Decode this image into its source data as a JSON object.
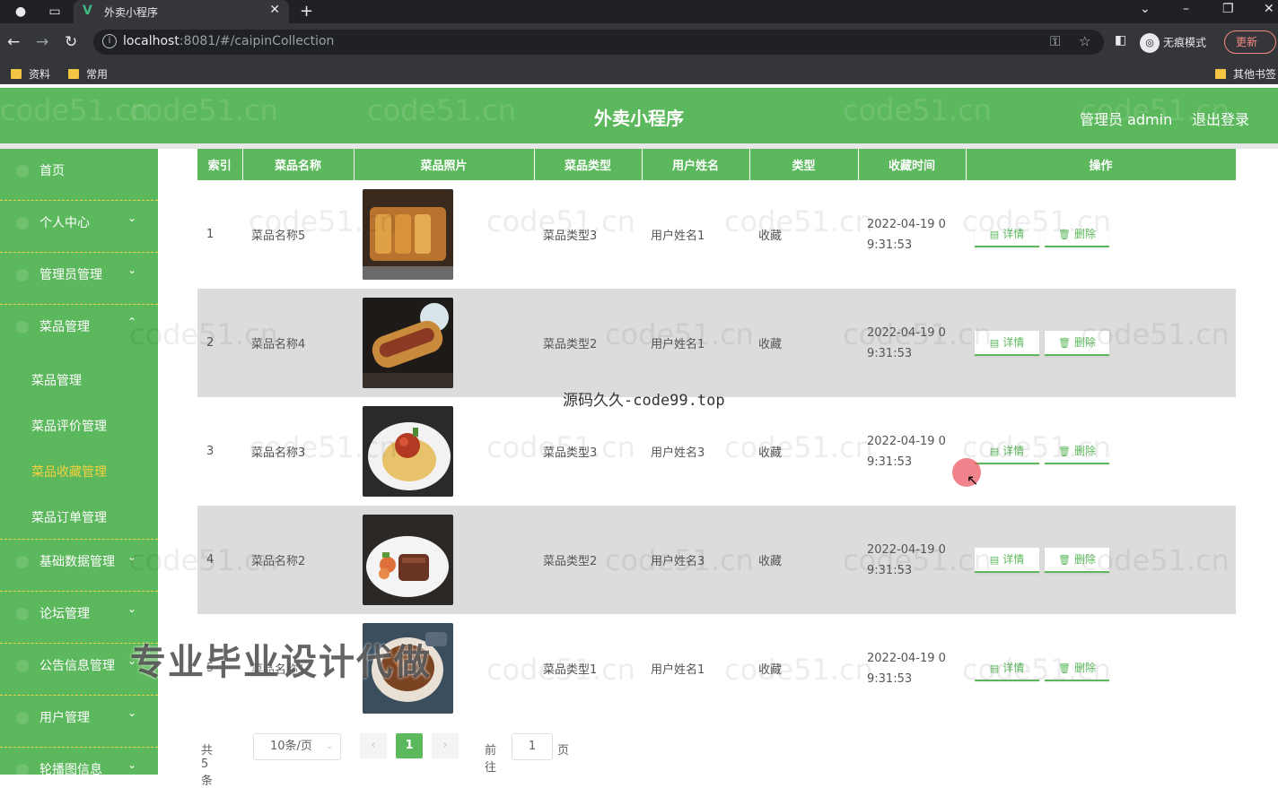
{
  "browser": {
    "tab_title": "外卖小程序",
    "tab_favicon": "V",
    "url_host": "localhost",
    "url_rest": ":8081/#/caipinCollection",
    "incognito_label": "无痕模式",
    "update_label": "更新",
    "bookmarks": [
      "资料",
      "常用"
    ],
    "other_bookmarks": "其他书签"
  },
  "header": {
    "title": "外卖小程序",
    "admin_label": "管理员 admin",
    "logout_label": "退出登录"
  },
  "sidebar": {
    "items": [
      {
        "label": "首页",
        "chevron": ""
      },
      {
        "label": "个人中心",
        "chevron": "⌄"
      },
      {
        "label": "管理员管理",
        "chevron": "⌄"
      },
      {
        "label": "菜品管理",
        "chevron": "⌃"
      }
    ],
    "subitems": [
      {
        "label": "菜品管理"
      },
      {
        "label": "菜品评价管理"
      },
      {
        "label": "菜品收藏管理",
        "active": true
      },
      {
        "label": "菜品订单管理"
      }
    ],
    "items_after": [
      {
        "label": "基础数据管理",
        "chevron": "⌄"
      },
      {
        "label": "论坛管理",
        "chevron": "⌄"
      },
      {
        "label": "公告信息管理",
        "chevron": "⌄"
      },
      {
        "label": "用户管理",
        "chevron": "⌄"
      },
      {
        "label": "轮播图信息",
        "chevron": "⌄"
      }
    ]
  },
  "table": {
    "columns": [
      "索引",
      "菜品名称",
      "菜品照片",
      "菜品类型",
      "用户姓名",
      "类型",
      "收藏时间",
      "操作"
    ],
    "rows": [
      {
        "index": "1",
        "name": "菜品名称5",
        "category": "菜品类型3",
        "user": "用户姓名1",
        "type": "收藏",
        "time1": "2022-04-19 0",
        "time2": "9:31:53"
      },
      {
        "index": "2",
        "name": "菜品名称4",
        "category": "菜品类型2",
        "user": "用户姓名1",
        "type": "收藏",
        "time1": "2022-04-19 0",
        "time2": "9:31:53"
      },
      {
        "index": "3",
        "name": "菜品名称3",
        "category": "菜品类型3",
        "user": "用户姓名3",
        "type": "收藏",
        "time1": "2022-04-19 0",
        "time2": "9:31:53"
      },
      {
        "index": "4",
        "name": "菜品名称2",
        "category": "菜品类型2",
        "user": "用户姓名3",
        "type": "收藏",
        "time1": "2022-04-19 0",
        "time2": "9:31:53"
      },
      {
        "index": "5",
        "name": "菜品名称1",
        "category": "菜品类型1",
        "user": "用户姓名1",
        "type": "收藏",
        "time1": "2022-04-19 0",
        "time2": "9:31:53"
      }
    ],
    "detail_label": "详情",
    "delete_label": "删除"
  },
  "pagination": {
    "total": "共 5 条",
    "page_size": "10条/页",
    "current": "1",
    "goto_label": "前往",
    "goto_value": "1",
    "page_suffix": "页"
  },
  "overlays": {
    "watermark": "code51.cn",
    "center_text": "源码久久-code99.top",
    "promo_text": "专业毕业设计代做"
  },
  "colors": {
    "brand_green": "#5cb85c",
    "active_menu": "#f4d03f"
  }
}
